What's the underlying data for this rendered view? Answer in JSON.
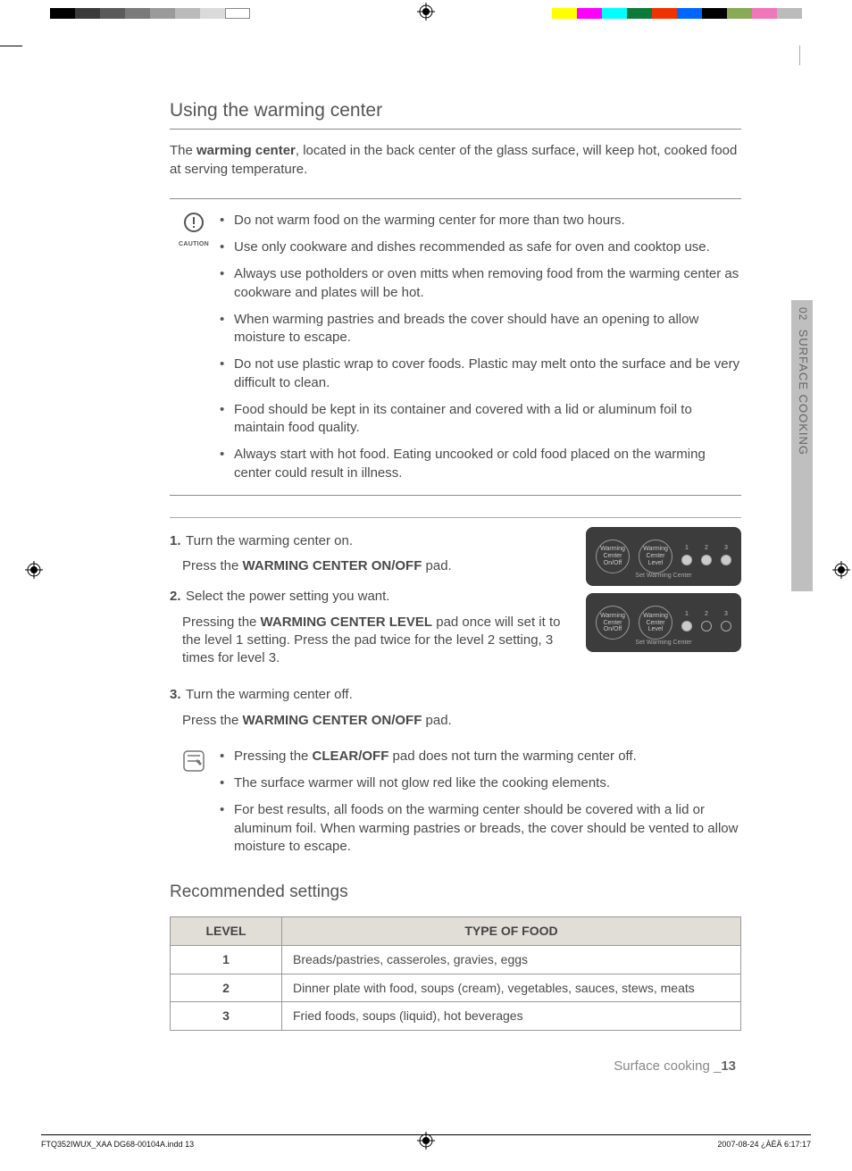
{
  "section_tab": {
    "num": "02",
    "label": "SURFACE COOKING"
  },
  "h1": "Using the warming center",
  "intro_prefix": "The ",
  "intro_bold": "warming center",
  "intro_rest": ", located in the back center of the glass surface, will keep hot, cooked food at serving temperature.",
  "caution_label": "CAUTION",
  "caution_items": [
    "Do not warm food on the warming center for more than two hours.",
    "Use only cookware and dishes recommended as safe for oven and cooktop use.",
    "Always use potholders or oven mitts when removing food from the warming center as cookware and plates will be hot.",
    "When warming pastries and breads the cover should have an opening to allow moisture to escape.",
    "Do not use plastic wrap to cover foods. Plastic may melt onto the surface and be very difficult to clean.",
    "Food should be kept in its container and covered with a lid or aluminum foil to maintain food quality.",
    "Always start with hot food. Eating uncooked or cold food placed on the warming center could result in illness."
  ],
  "steps": [
    {
      "num": "1.",
      "title": "Turn the warming center on.",
      "sub_pre": "Press the ",
      "sub_bold": "WARMING CENTER ON/OFF",
      "sub_post": " pad.",
      "sub2_pre": "",
      "sub2_bold": "",
      "sub2_post": ""
    },
    {
      "num": "2.",
      "title": "Select the power setting you want.",
      "sub_pre": "Pressing the ",
      "sub_bold": "WARMING CENTER LEVEL",
      "sub_post": " pad once will set it to the level 1 setting. Press the pad twice for the level 2 setting, 3 times for level 3.",
      "sub2_pre": "",
      "sub2_bold": "",
      "sub2_post": ""
    },
    {
      "num": "3.",
      "title": "Turn the warming center off.",
      "sub_pre": "Press the ",
      "sub_bold": "WARMING CENTER ON/OFF",
      "sub_post": " pad.",
      "sub2_pre": "",
      "sub2_bold": "",
      "sub2_post": ""
    }
  ],
  "panel": {
    "btn1_l1": "Warming",
    "btn1_l2": "Center",
    "btn1_l3": "On/Off",
    "btn2_l1": "Warming",
    "btn2_l2": "Center",
    "btn2_l3": "Level",
    "sub": "Set  Warming Center"
  },
  "notes_items": [
    {
      "pre": "Pressing the ",
      "bold": "CLEAR/OFF",
      "post": " pad does not turn the warming center off."
    },
    {
      "pre": "",
      "bold": "",
      "post": "The surface warmer will not glow red like the cooking elements."
    },
    {
      "pre": "",
      "bold": "",
      "post": "For best results, all foods on the warming center should be covered with a lid or aluminum foil. When warming pastries or breads, the cover should be vented to allow moisture to escape."
    }
  ],
  "rec_title": "Recommended settings",
  "table": {
    "head_level": "LEVEL",
    "head_type": "TYPE OF FOOD",
    "rows": [
      {
        "level": "1",
        "type": "Breads/pastries, casseroles, gravies, eggs"
      },
      {
        "level": "2",
        "type": "Dinner plate with food, soups (cream), vegetables, sauces, stews, meats"
      },
      {
        "level": "3",
        "type": "Fried foods, soups (liquid), hot beverages"
      }
    ]
  },
  "footer_section": "Surface cooking _",
  "footer_page": "13",
  "print_left": "FTQ352IWUX_XAA DG68-00104A.indd   13",
  "print_right": "2007-08-24   ¿ÀÈÄ 6:17:17"
}
